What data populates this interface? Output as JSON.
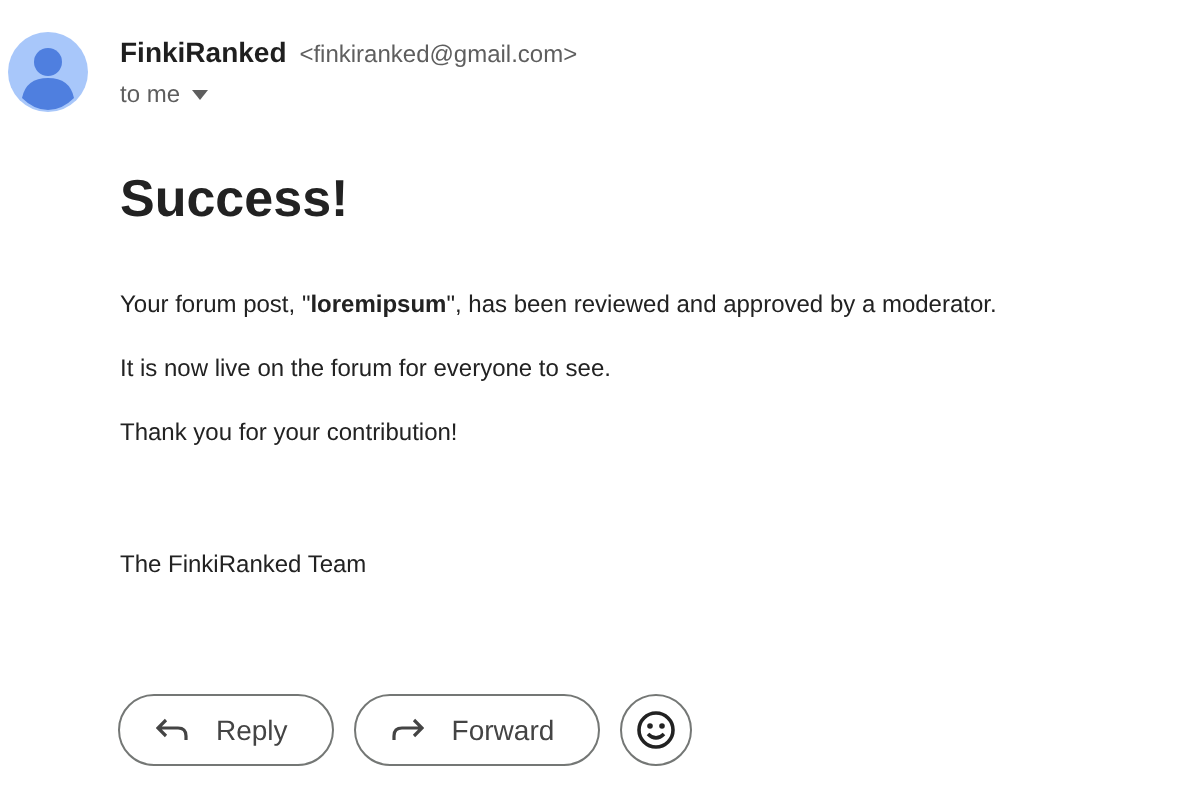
{
  "sender": {
    "name": "FinkiRanked",
    "address": "<finkiranked@gmail.com>",
    "recipient": "to me"
  },
  "message": {
    "heading": "Success!",
    "paragraphs": [
      "Your forum post, \"**loremipsum**\", has been reviewed and approved by a moderator.",
      "It is now live on the forum for everyone to see.",
      "Thank you for your contribution!"
    ],
    "signature": "The FinkiRanked Team"
  },
  "actions": [
    {
      "kind": "reply",
      "label": "Reply"
    },
    {
      "kind": "forward",
      "label": "Forward"
    },
    {
      "kind": "emoji"
    }
  ]
}
